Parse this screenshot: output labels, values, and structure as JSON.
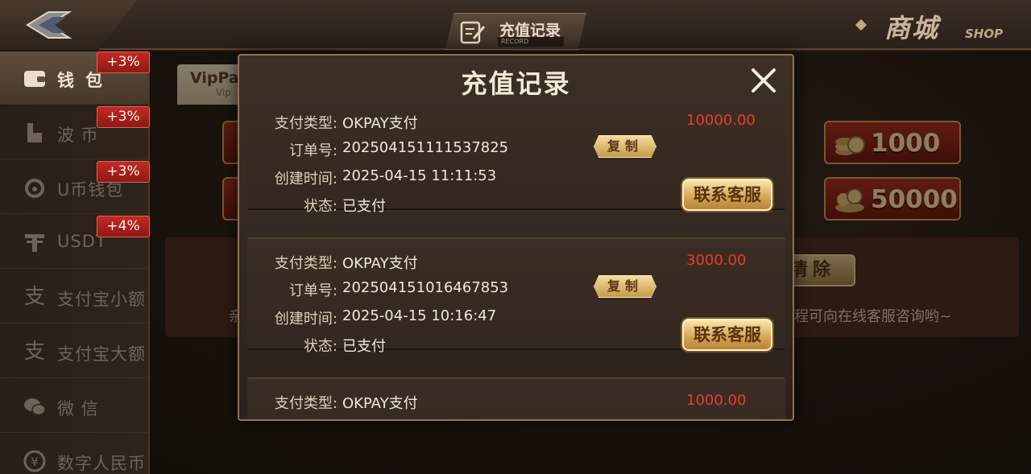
{
  "header": {
    "title": "充值记录",
    "title_sub": "RECORD",
    "shop_cn": "商城",
    "shop_en": "SHOP"
  },
  "sidebar": {
    "items": [
      {
        "label": "钱包",
        "badge": "+3%",
        "icon": "wallet-icon",
        "active": true
      },
      {
        "label": "波 币",
        "badge": "+3%",
        "icon": "bobi-icon",
        "active": false
      },
      {
        "label": "U币钱包",
        "badge": "+3%",
        "icon": "u-coin-icon",
        "active": false
      },
      {
        "label": "USDT",
        "badge": "+4%",
        "icon": "usdt-icon",
        "active": false
      },
      {
        "label": "支付宝小额",
        "badge": "",
        "icon": "alipay-icon",
        "active": false
      },
      {
        "label": "支付宝大额",
        "badge": "",
        "icon": "alipay-icon",
        "active": false
      },
      {
        "label": "微 信",
        "badge": "",
        "icon": "wechat-icon",
        "active": false
      },
      {
        "label": "数字人民币",
        "badge": "",
        "icon": "digital-rmb-icon",
        "active": false
      }
    ]
  },
  "background": {
    "vip_tab": "VipPa",
    "vip_tab_sub": "Vip",
    "amounts": [
      "1000",
      "50000"
    ],
    "clear_label": "清除",
    "info_text": "程可向在线客服咨询哟~",
    "info_stub": "亲"
  },
  "modal": {
    "title": "充值记录",
    "labels": {
      "pay_type": "支付类型:",
      "order_no": "订单号:",
      "created": "创建时间:",
      "status": "状态:"
    },
    "copy_label": "复制",
    "service_label": "联系客服",
    "records": [
      {
        "pay_type": "OKPAY支付",
        "amount": "10000.00",
        "order_no": "2025041511115378​25",
        "created": "2025-04-15 11:11:53",
        "status": "已支付"
      },
      {
        "pay_type": "OKPAY支付",
        "amount": "3000.00",
        "order_no": "202504151016467853",
        "created": "2025-04-15 10:16:47",
        "status": "已支付"
      },
      {
        "pay_type": "OKPAY支付",
        "amount": "1000.00",
        "order_no": "",
        "created": "",
        "status": ""
      }
    ]
  },
  "colors": {
    "accent_gold": "#d2a352",
    "amount_red": "#ea3a2e",
    "badge_red": "#c22a22"
  }
}
